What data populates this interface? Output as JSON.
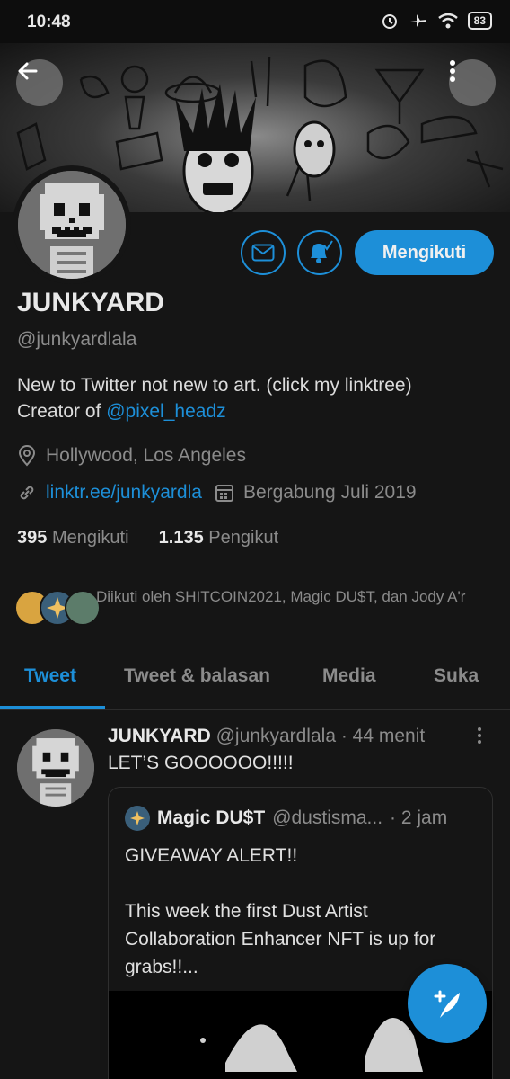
{
  "status_bar": {
    "time": "10:48",
    "battery": "83"
  },
  "profile": {
    "name": "JUNKYARD",
    "handle": "@junkyardlala",
    "bio_text": "New to Twitter not new to art. (click my linktree)",
    "bio_prefix": "Creator of ",
    "bio_mention": "@pixel_headz",
    "location": "Hollywood, Los Angeles",
    "website": "linktr.ee/junkyardla",
    "joined": "Bergabung Juli 2019",
    "following_count": "395",
    "following_label": "Mengikuti",
    "followers_count": "1.135",
    "followers_label": "Pengikut",
    "follow_button": "Mengikuti",
    "followed_by": "Diikuti oleh SHITCOIN2021, Magic DU$T, dan Jody A'r"
  },
  "tabs": [
    {
      "label": "Tweet"
    },
    {
      "label": "Tweet & balasan"
    },
    {
      "label": "Media"
    },
    {
      "label": "Suka"
    }
  ],
  "tweet": {
    "author": "JUNKYARD",
    "handle": "@junkyardlala",
    "time": "· 44 menit",
    "text": "LET’S GOOOOOO!!!!!",
    "quote": {
      "author": "Magic DU$T",
      "handle": "@dustisma...",
      "time": "· 2 jam",
      "text": "GIVEAWAY ALERT!!\n\nThis week the first Dust Artist Collaboration Enhancer NFT is up for grabs!!..."
    }
  },
  "colors": {
    "accent": "#1d8fd8",
    "background": "#151515",
    "muted": "#8b8b8b"
  },
  "icons": [
    "back-arrow-icon",
    "more-vertical-icon",
    "mail-icon",
    "bell-icon",
    "location-icon",
    "link-icon",
    "calendar-icon",
    "compose-icon"
  ]
}
